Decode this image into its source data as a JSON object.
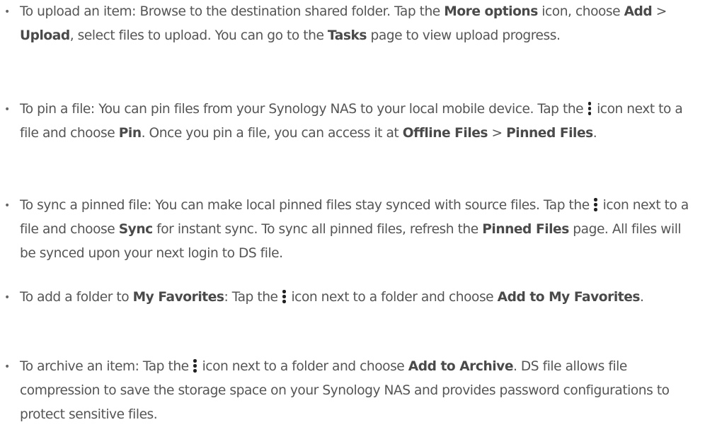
{
  "items": [
    {
      "t1": "To upload an item: Browse to the destination shared folder. Tap the ",
      "b1": "More options",
      "t2": " icon, choose ",
      "b2": "Add",
      "t3": " > ",
      "b3": "Upload",
      "t4": ", select files to upload. You can go to the ",
      "b4": "Tasks",
      "t5": " page to view upload progress."
    },
    {
      "t1": "To pin a file: You can pin files from your Synology NAS to your local mobile device. Tap the ",
      "icon": "more-vertical-icon",
      "t2": " icon next to a file and choose ",
      "b1": "Pin",
      "t3": ". Once you pin a file, you can access it at ",
      "b2": "Offline Files",
      "t4": " > ",
      "b3": "Pinned Files",
      "t5": "."
    },
    {
      "t1": "To sync a pinned file: You can make local pinned files stay synced with source files. Tap the ",
      "icon": "more-vertical-icon",
      "t2": " icon next to a file and choose ",
      "b1": "Sync",
      "t3": " for instant sync. To sync all pinned files, refresh the ",
      "b2": "Pinned Files",
      "t4": " page. All files will be synced upon your next login to DS file."
    },
    {
      "t1": "To add a folder to ",
      "b1": "My Favorites",
      "t2": ": Tap the ",
      "icon": "more-vertical-icon",
      "t3": " icon next to a folder and choose ",
      "b2": "Add to My Favorites",
      "t4": "."
    },
    {
      "t1": "To archive an item: Tap the ",
      "icon": "more-vertical-icon",
      "t2": " icon next to a folder and choose ",
      "b1": "Add to Archive",
      "t3": ". DS file allows file compression to save the storage space on your Synology NAS and provides password configurations to protect sensitive files."
    }
  ]
}
